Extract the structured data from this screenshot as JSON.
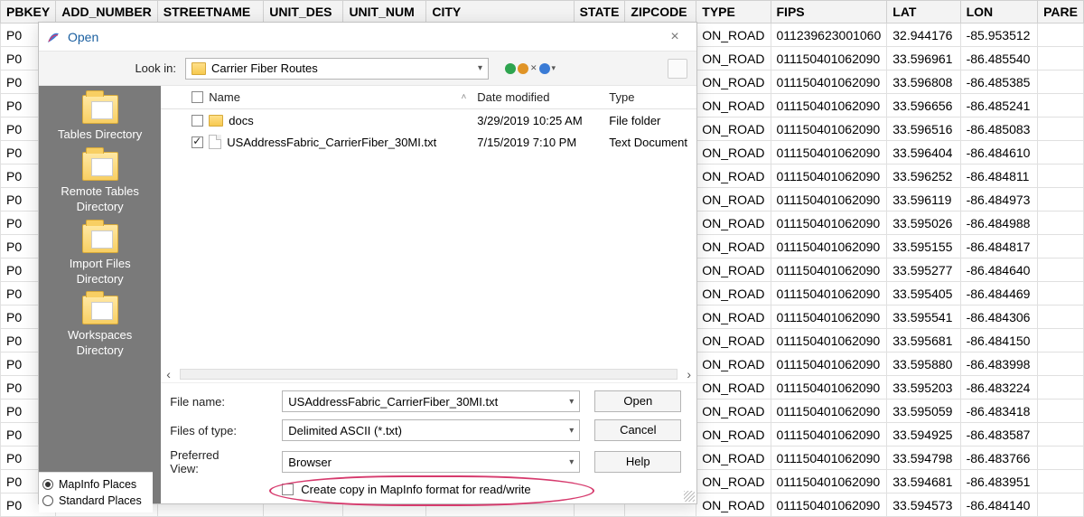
{
  "columns": [
    "PBKEY",
    "ADD_NUMBER",
    "STREETNAME",
    "UNIT_DES",
    "UNIT_NUM",
    "CITY",
    "STATE",
    "ZIPCODE",
    "TYPE",
    "FIPS",
    "LAT",
    "LON",
    "PARE"
  ],
  "rows": [
    {
      "pbkey": "P0",
      "type": "ON_ROAD",
      "fips": "011239623001060",
      "lat": "32.944176",
      "lon": "-85.953512"
    },
    {
      "pbkey": "P0",
      "type": "ON_ROAD",
      "fips": "011150401062090",
      "lat": "33.596961",
      "lon": "-86.485540"
    },
    {
      "pbkey": "P0",
      "type": "ON_ROAD",
      "fips": "011150401062090",
      "lat": "33.596808",
      "lon": "-86.485385"
    },
    {
      "pbkey": "P0",
      "type": "ON_ROAD",
      "fips": "011150401062090",
      "lat": "33.596656",
      "lon": "-86.485241"
    },
    {
      "pbkey": "P0",
      "type": "ON_ROAD",
      "fips": "011150401062090",
      "lat": "33.596516",
      "lon": "-86.485083"
    },
    {
      "pbkey": "P0",
      "type": "ON_ROAD",
      "fips": "011150401062090",
      "lat": "33.596404",
      "lon": "-86.484610"
    },
    {
      "pbkey": "P0",
      "type": "ON_ROAD",
      "fips": "011150401062090",
      "lat": "33.596252",
      "lon": "-86.484811"
    },
    {
      "pbkey": "P0",
      "type": "ON_ROAD",
      "fips": "011150401062090",
      "lat": "33.596119",
      "lon": "-86.484973"
    },
    {
      "pbkey": "P0",
      "type": "ON_ROAD",
      "fips": "011150401062090",
      "lat": "33.595026",
      "lon": "-86.484988"
    },
    {
      "pbkey": "P0",
      "type": "ON_ROAD",
      "fips": "011150401062090",
      "lat": "33.595155",
      "lon": "-86.484817"
    },
    {
      "pbkey": "P0",
      "type": "ON_ROAD",
      "fips": "011150401062090",
      "lat": "33.595277",
      "lon": "-86.484640"
    },
    {
      "pbkey": "P0",
      "type": "ON_ROAD",
      "fips": "011150401062090",
      "lat": "33.595405",
      "lon": "-86.484469"
    },
    {
      "pbkey": "P0",
      "type": "ON_ROAD",
      "fips": "011150401062090",
      "lat": "33.595541",
      "lon": "-86.484306"
    },
    {
      "pbkey": "P0",
      "type": "ON_ROAD",
      "fips": "011150401062090",
      "lat": "33.595681",
      "lon": "-86.484150"
    },
    {
      "pbkey": "P0",
      "type": "ON_ROAD",
      "fips": "011150401062090",
      "lat": "33.595880",
      "lon": "-86.483998"
    },
    {
      "pbkey": "P0",
      "type": "ON_ROAD",
      "fips": "011150401062090",
      "lat": "33.595203",
      "lon": "-86.483224"
    },
    {
      "pbkey": "P0",
      "type": "ON_ROAD",
      "fips": "011150401062090",
      "lat": "33.595059",
      "lon": "-86.483418"
    },
    {
      "pbkey": "P0",
      "type": "ON_ROAD",
      "fips": "011150401062090",
      "lat": "33.594925",
      "lon": "-86.483587"
    },
    {
      "pbkey": "P0",
      "type": "ON_ROAD",
      "fips": "011150401062090",
      "lat": "33.594798",
      "lon": "-86.483766"
    },
    {
      "pbkey": "P0",
      "type": "ON_ROAD",
      "fips": "011150401062090",
      "lat": "33.594681",
      "lon": "-86.483951"
    },
    {
      "pbkey": "P0",
      "type": "ON_ROAD",
      "fips": "011150401062090",
      "lat": "33.594573",
      "lon": "-86.484140"
    }
  ],
  "dialog": {
    "title": "Open",
    "lookin_label": "Look in:",
    "lookin_value": "Carrier Fiber Routes",
    "sidebar": [
      "Tables Directory",
      "Remote Tables Directory",
      "Import Files Directory",
      "Workspaces Directory"
    ],
    "list_headers": {
      "name": "Name",
      "date": "Date modified",
      "type": "Type"
    },
    "files": [
      {
        "checked": false,
        "icon": "folder",
        "name": "docs",
        "date": "3/29/2019 10:25 AM",
        "type": "File folder"
      },
      {
        "checked": true,
        "icon": "file",
        "name": "USAddressFabric_CarrierFiber_30MI.txt",
        "date": "7/15/2019 7:10 PM",
        "type": "Text Document"
      }
    ],
    "filename_label": "File name:",
    "filename_value": "USAddressFabric_CarrierFiber_30MI.txt",
    "filetype_label": "Files of type:",
    "filetype_value": "Delimited ASCII (*.txt)",
    "prefview_label_top": "Preferred",
    "prefview_label_bot": "View:",
    "prefview_value": "Browser",
    "copy_label": "Create copy in MapInfo format for read/write",
    "buttons": {
      "open": "Open",
      "cancel": "Cancel",
      "help": "Help"
    },
    "places": {
      "mi": "MapInfo Places",
      "std": "Standard Places"
    }
  }
}
